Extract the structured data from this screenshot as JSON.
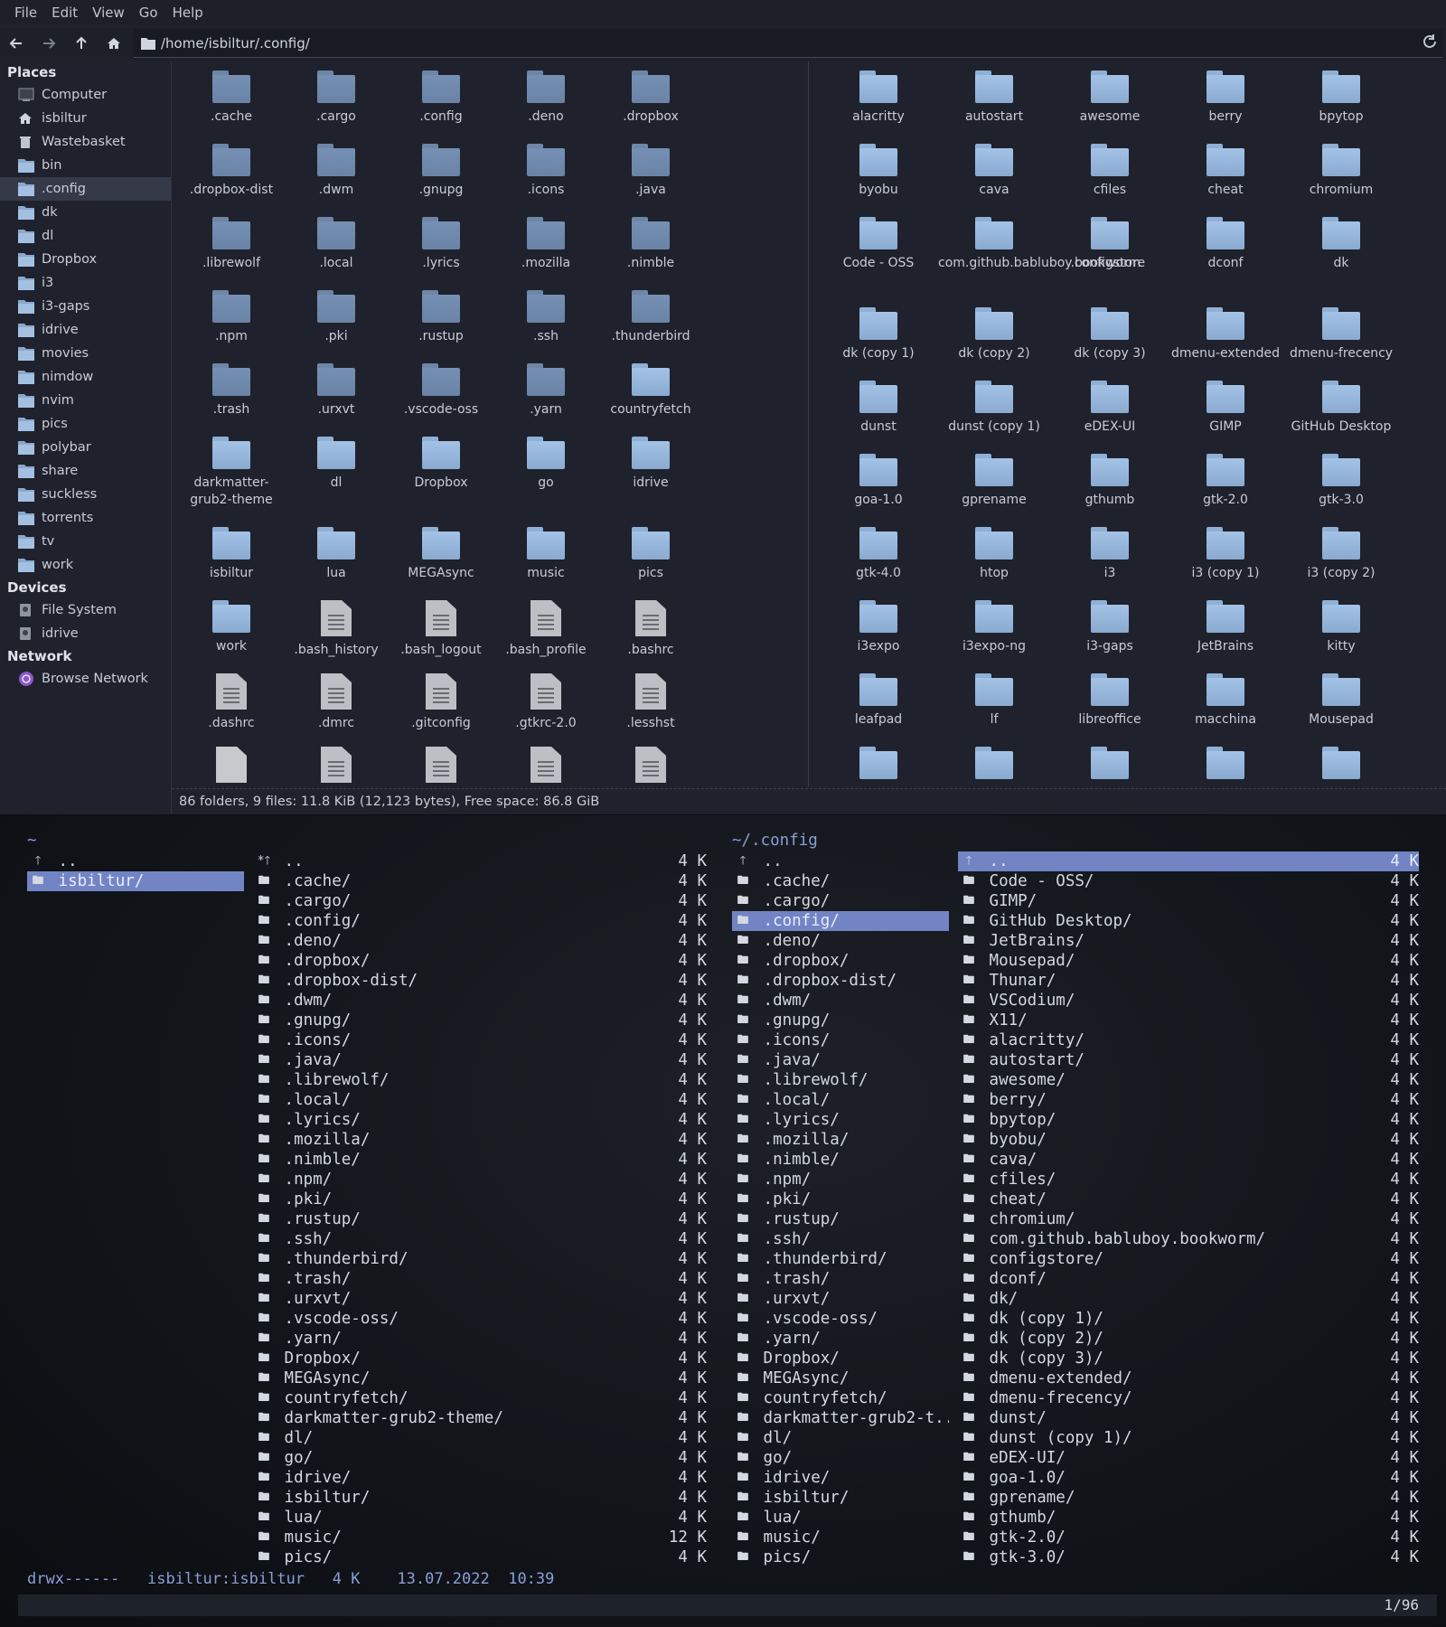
{
  "fm": {
    "menu": [
      "File",
      "Edit",
      "View",
      "Go",
      "Help"
    ],
    "path": "/home/isbiltur/.config/",
    "places_label": "Places",
    "places": [
      {
        "label": "Computer",
        "icon": "computer-icon"
      },
      {
        "label": "isbiltur",
        "icon": "home-icon"
      },
      {
        "label": "Wastebasket",
        "icon": "trash-icon"
      },
      {
        "label": "bin",
        "icon": "folder-icon"
      },
      {
        "label": ".config",
        "icon": "folder-icon",
        "selected": true
      },
      {
        "label": "dk",
        "icon": "folder-icon"
      },
      {
        "label": "dl",
        "icon": "folder-icon"
      },
      {
        "label": "Dropbox",
        "icon": "folder-icon"
      },
      {
        "label": "i3",
        "icon": "folder-icon"
      },
      {
        "label": "i3-gaps",
        "icon": "folder-icon"
      },
      {
        "label": "idrive",
        "icon": "folder-icon"
      },
      {
        "label": "movies",
        "icon": "folder-icon"
      },
      {
        "label": "nimdow",
        "icon": "folder-icon"
      },
      {
        "label": "nvim",
        "icon": "folder-icon"
      },
      {
        "label": "pics",
        "icon": "folder-icon"
      },
      {
        "label": "polybar",
        "icon": "folder-icon"
      },
      {
        "label": "share",
        "icon": "folder-icon"
      },
      {
        "label": "suckless",
        "icon": "folder-icon"
      },
      {
        "label": "torrents",
        "icon": "folder-icon"
      },
      {
        "label": "tv",
        "icon": "folder-icon"
      },
      {
        "label": "work",
        "icon": "folder-icon"
      }
    ],
    "devices_label": "Devices",
    "devices": [
      {
        "label": "File System",
        "icon": "drive-icon"
      },
      {
        "label": "idrive",
        "icon": "drive-icon"
      }
    ],
    "network_label": "Network",
    "network": [
      {
        "label": "Browse Network",
        "icon": "network-icon"
      }
    ],
    "left_items": [
      {
        "n": ".cache",
        "t": "dot"
      },
      {
        "n": ".cargo",
        "t": "dot"
      },
      {
        "n": ".config",
        "t": "dot"
      },
      {
        "n": ".deno",
        "t": "dot"
      },
      {
        "n": ".dropbox",
        "t": "dot"
      },
      {
        "n": ".dropbox-dist",
        "t": "dot"
      },
      {
        "n": ".dwm",
        "t": "dot"
      },
      {
        "n": ".gnupg",
        "t": "dot"
      },
      {
        "n": ".icons",
        "t": "dot"
      },
      {
        "n": ".java",
        "t": "dot"
      },
      {
        "n": ".librewolf",
        "t": "dot"
      },
      {
        "n": ".local",
        "t": "dot"
      },
      {
        "n": ".lyrics",
        "t": "dot"
      },
      {
        "n": ".mozilla",
        "t": "dot"
      },
      {
        "n": ".nimble",
        "t": "dot"
      },
      {
        "n": ".npm",
        "t": "dot"
      },
      {
        "n": ".pki",
        "t": "dot"
      },
      {
        "n": ".rustup",
        "t": "dot"
      },
      {
        "n": ".ssh",
        "t": "dot"
      },
      {
        "n": ".thunderbird",
        "t": "dot"
      },
      {
        "n": ".trash",
        "t": "dot"
      },
      {
        "n": ".urxvt",
        "t": "dot"
      },
      {
        "n": ".vscode-oss",
        "t": "dot"
      },
      {
        "n": ".yarn",
        "t": "dot"
      },
      {
        "n": "countryfetch",
        "t": "norm"
      },
      {
        "n": "darkmatter-grub2-theme",
        "t": "norm",
        "tall": true
      },
      {
        "n": "dl",
        "t": "norm",
        "tall": true
      },
      {
        "n": "Dropbox",
        "t": "norm",
        "tall": true
      },
      {
        "n": "go",
        "t": "norm",
        "tall": true
      },
      {
        "n": "idrive",
        "t": "norm",
        "tall": true
      },
      {
        "n": "isbiltur",
        "t": "norm"
      },
      {
        "n": "lua",
        "t": "norm"
      },
      {
        "n": "MEGAsync",
        "t": "norm"
      },
      {
        "n": "music",
        "t": "norm"
      },
      {
        "n": "pics",
        "t": "norm"
      },
      {
        "n": "work",
        "t": "norm"
      },
      {
        "n": ".bash_history",
        "t": "doc"
      },
      {
        "n": ".bash_logout",
        "t": "doc"
      },
      {
        "n": ".bash_profile",
        "t": "doc"
      },
      {
        "n": ".bashrc",
        "t": "doc"
      },
      {
        "n": ".dashrc",
        "t": "doc"
      },
      {
        "n": ".dmrc",
        "t": "doc"
      },
      {
        "n": ".gitconfig",
        "t": "doc"
      },
      {
        "n": ".gtkrc-2.0",
        "t": "doc"
      },
      {
        "n": ".lesshst",
        "t": "doc"
      },
      {
        "n": "",
        "t": "blank"
      },
      {
        "n": "",
        "t": "doc"
      },
      {
        "n": "",
        "t": "doc"
      },
      {
        "n": "",
        "t": "doc"
      },
      {
        "n": "",
        "t": "doc"
      }
    ],
    "right_items": [
      {
        "n": "alacritty"
      },
      {
        "n": "autostart"
      },
      {
        "n": "awesome"
      },
      {
        "n": "berry"
      },
      {
        "n": "bpytop"
      },
      {
        "n": "byobu"
      },
      {
        "n": "cava"
      },
      {
        "n": "cfiles"
      },
      {
        "n": "cheat"
      },
      {
        "n": "chromium"
      },
      {
        "n": "Code - OSS",
        "tall": true
      },
      {
        "n": "com.github.babluboy.bookworm",
        "tall": true
      },
      {
        "n": "configstore",
        "tall": true
      },
      {
        "n": "dconf",
        "tall": true
      },
      {
        "n": "dk",
        "tall": true
      },
      {
        "n": "dk (copy 1)"
      },
      {
        "n": "dk (copy 2)"
      },
      {
        "n": "dk (copy 3)"
      },
      {
        "n": "dmenu-extended"
      },
      {
        "n": "dmenu-frecency"
      },
      {
        "n": "dunst"
      },
      {
        "n": "dunst (copy 1)"
      },
      {
        "n": "eDEX-UI"
      },
      {
        "n": "GIMP"
      },
      {
        "n": "GitHub Desktop"
      },
      {
        "n": "goa-1.0"
      },
      {
        "n": "gprename"
      },
      {
        "n": "gthumb"
      },
      {
        "n": "gtk-2.0"
      },
      {
        "n": "gtk-3.0"
      },
      {
        "n": "gtk-4.0"
      },
      {
        "n": "htop"
      },
      {
        "n": "i3"
      },
      {
        "n": "i3 (copy 1)"
      },
      {
        "n": "i3 (copy 2)"
      },
      {
        "n": "i3expo"
      },
      {
        "n": "i3expo-ng"
      },
      {
        "n": "i3-gaps"
      },
      {
        "n": "JetBrains"
      },
      {
        "n": "kitty"
      },
      {
        "n": "leafpad"
      },
      {
        "n": "lf"
      },
      {
        "n": "libreoffice"
      },
      {
        "n": "macchina"
      },
      {
        "n": "Mousepad"
      },
      {
        "n": ""
      },
      {
        "n": ""
      },
      {
        "n": ""
      },
      {
        "n": ""
      },
      {
        "n": ""
      }
    ],
    "status": "86 folders, 9 files: 11.8 KiB (12,123 bytes), Free space: 86.8 GiB"
  },
  "term": {
    "col1_head": "~",
    "col1": [
      {
        "n": "..",
        "i": "up"
      },
      {
        "n": "isbiltur/",
        "i": "dir",
        "sel": true
      }
    ],
    "col2": [
      {
        "n": "..",
        "i": "up2",
        "s": "4 K"
      },
      {
        "n": ".cache/",
        "s": "4 K"
      },
      {
        "n": ".cargo/",
        "s": "4 K"
      },
      {
        "n": ".config/",
        "s": "4 K"
      },
      {
        "n": ".deno/",
        "s": "4 K"
      },
      {
        "n": ".dropbox/",
        "s": "4 K"
      },
      {
        "n": ".dropbox-dist/",
        "s": "4 K"
      },
      {
        "n": ".dwm/",
        "s": "4 K"
      },
      {
        "n": ".gnupg/",
        "s": "4 K"
      },
      {
        "n": ".icons/",
        "s": "4 K"
      },
      {
        "n": ".java/",
        "s": "4 K"
      },
      {
        "n": ".librewolf/",
        "s": "4 K"
      },
      {
        "n": ".local/",
        "s": "4 K"
      },
      {
        "n": ".lyrics/",
        "s": "4 K"
      },
      {
        "n": ".mozilla/",
        "s": "4 K"
      },
      {
        "n": ".nimble/",
        "s": "4 K"
      },
      {
        "n": ".npm/",
        "s": "4 K"
      },
      {
        "n": ".pki/",
        "s": "4 K"
      },
      {
        "n": ".rustup/",
        "s": "4 K"
      },
      {
        "n": ".ssh/",
        "s": "4 K"
      },
      {
        "n": ".thunderbird/",
        "s": "4 K"
      },
      {
        "n": ".trash/",
        "s": "4 K"
      },
      {
        "n": ".urxvt/",
        "s": "4 K"
      },
      {
        "n": ".vscode-oss/",
        "s": "4 K"
      },
      {
        "n": ".yarn/",
        "s": "4 K"
      },
      {
        "n": "Dropbox/",
        "s": "4 K"
      },
      {
        "n": "MEGAsync/",
        "s": "4 K"
      },
      {
        "n": "countryfetch/",
        "s": "4 K"
      },
      {
        "n": "darkmatter-grub2-theme/",
        "s": "4 K"
      },
      {
        "n": "dl/",
        "s": "4 K"
      },
      {
        "n": "go/",
        "s": "4 K"
      },
      {
        "n": "idrive/",
        "s": "4 K"
      },
      {
        "n": "isbiltur/",
        "s": "4 K"
      },
      {
        "n": "lua/",
        "s": "4 K"
      },
      {
        "n": "music/",
        "s": "12 K"
      },
      {
        "n": "pics/",
        "s": "4 K"
      }
    ],
    "col3_head": "~/.config",
    "col3": [
      {
        "n": "..",
        "i": "up"
      },
      {
        "n": ".cache/"
      },
      {
        "n": ".cargo/"
      },
      {
        "n": ".config/",
        "sel": true
      },
      {
        "n": ".deno/"
      },
      {
        "n": ".dropbox/"
      },
      {
        "n": ".dropbox-dist/"
      },
      {
        "n": ".dwm/"
      },
      {
        "n": ".gnupg/"
      },
      {
        "n": ".icons/"
      },
      {
        "n": ".java/"
      },
      {
        "n": ".librewolf/"
      },
      {
        "n": ".local/"
      },
      {
        "n": ".lyrics/"
      },
      {
        "n": ".mozilla/"
      },
      {
        "n": ".nimble/"
      },
      {
        "n": ".npm/"
      },
      {
        "n": ".pki/"
      },
      {
        "n": ".rustup/"
      },
      {
        "n": ".ssh/"
      },
      {
        "n": ".thunderbird/"
      },
      {
        "n": ".trash/"
      },
      {
        "n": ".urxvt/"
      },
      {
        "n": ".vscode-oss/"
      },
      {
        "n": ".yarn/"
      },
      {
        "n": "Dropbox/"
      },
      {
        "n": "MEGAsync/"
      },
      {
        "n": "countryfetch/"
      },
      {
        "n": "darkmatter-grub2-t.."
      },
      {
        "n": "dl/"
      },
      {
        "n": "go/"
      },
      {
        "n": "idrive/"
      },
      {
        "n": "isbiltur/"
      },
      {
        "n": "lua/"
      },
      {
        "n": "music/"
      },
      {
        "n": "pics/"
      }
    ],
    "col4": [
      {
        "n": "..",
        "i": "up",
        "s": "4 K",
        "sel": true
      },
      {
        "n": "Code - OSS/",
        "s": "4 K"
      },
      {
        "n": "GIMP/",
        "s": "4 K"
      },
      {
        "n": "GitHub Desktop/",
        "s": "4 K"
      },
      {
        "n": "JetBrains/",
        "s": "4 K"
      },
      {
        "n": "Mousepad/",
        "s": "4 K"
      },
      {
        "n": "Thunar/",
        "s": "4 K"
      },
      {
        "n": "VSCodium/",
        "s": "4 K"
      },
      {
        "n": "X11/",
        "s": "4 K"
      },
      {
        "n": "alacritty/",
        "s": "4 K"
      },
      {
        "n": "autostart/",
        "s": "4 K"
      },
      {
        "n": "awesome/",
        "s": "4 K"
      },
      {
        "n": "berry/",
        "s": "4 K"
      },
      {
        "n": "bpytop/",
        "s": "4 K"
      },
      {
        "n": "byobu/",
        "s": "4 K"
      },
      {
        "n": "cava/",
        "s": "4 K"
      },
      {
        "n": "cfiles/",
        "s": "4 K"
      },
      {
        "n": "cheat/",
        "s": "4 K"
      },
      {
        "n": "chromium/",
        "s": "4 K"
      },
      {
        "n": "com.github.babluboy.bookworm/",
        "s": "4 K"
      },
      {
        "n": "configstore/",
        "s": "4 K"
      },
      {
        "n": "dconf/",
        "s": "4 K"
      },
      {
        "n": "dk/",
        "s": "4 K"
      },
      {
        "n": "dk (copy 1)/",
        "s": "4 K"
      },
      {
        "n": "dk (copy 2)/",
        "s": "4 K"
      },
      {
        "n": "dk (copy 3)/",
        "s": "4 K"
      },
      {
        "n": "dmenu-extended/",
        "s": "4 K"
      },
      {
        "n": "dmenu-frecency/",
        "s": "4 K"
      },
      {
        "n": "dunst/",
        "s": "4 K"
      },
      {
        "n": "dunst (copy 1)/",
        "s": "4 K"
      },
      {
        "n": "eDEX-UI/",
        "s": "4 K"
      },
      {
        "n": "goa-1.0/",
        "s": "4 K"
      },
      {
        "n": "gprename/",
        "s": "4 K"
      },
      {
        "n": "gthumb/",
        "s": "4 K"
      },
      {
        "n": "gtk-2.0/",
        "s": "4 K"
      },
      {
        "n": "gtk-3.0/",
        "s": "4 K"
      }
    ],
    "status_line": "drwx------   isbiltur:isbiltur   4 K    13.07.2022  10:39",
    "position": "1/96",
    "glyph_dir": "🖿",
    "glyph_up": "🡑",
    "glyph_up2": "*🡑"
  }
}
